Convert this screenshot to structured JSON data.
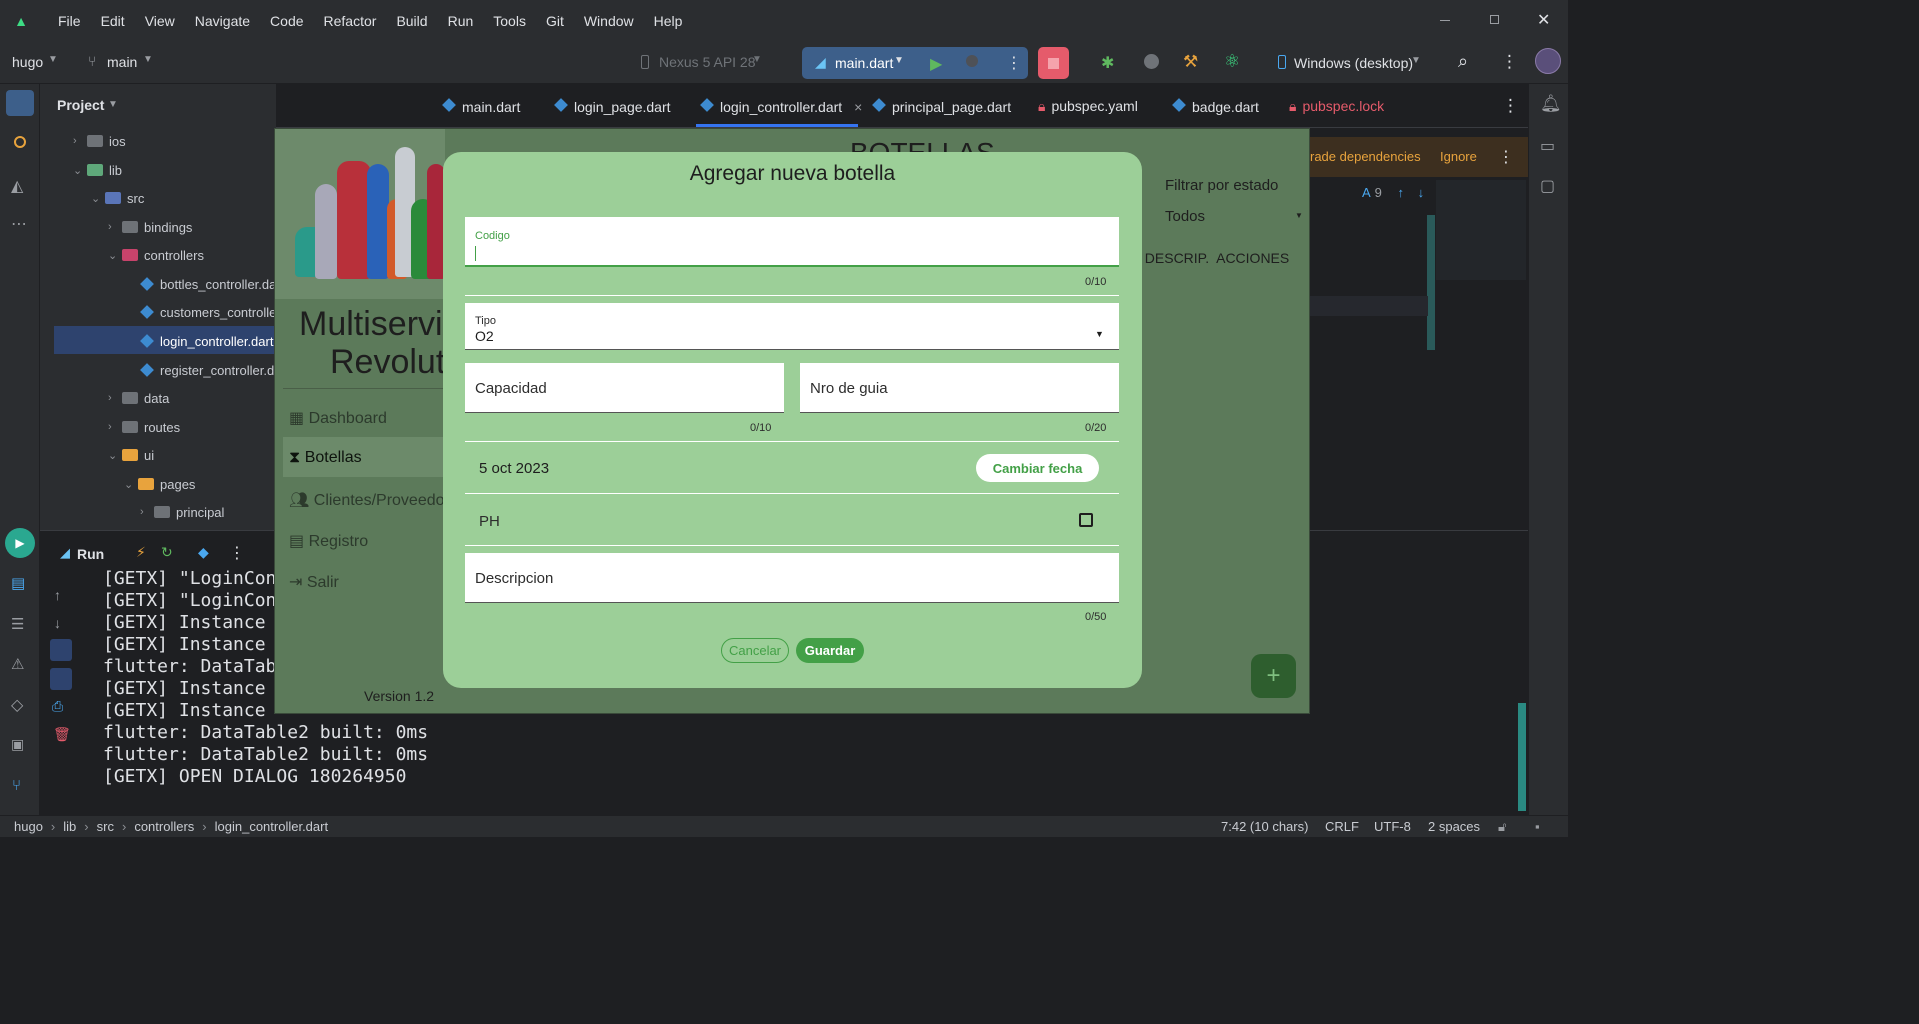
{
  "menubar": {
    "items": [
      "File",
      "Edit",
      "View",
      "Navigate",
      "Code",
      "Refactor",
      "Build",
      "Run",
      "Tools",
      "Git",
      "Window",
      "Help"
    ]
  },
  "toolbar": {
    "project": "hugo",
    "branch": "main",
    "device": "Nexus 5 API 28",
    "run_config": "main.dart",
    "target": "Windows (desktop)"
  },
  "project_panel": {
    "title": "Project",
    "tree": [
      {
        "label": "ios",
        "kind": "folder"
      },
      {
        "label": "lib",
        "kind": "folder"
      },
      {
        "label": "src",
        "kind": "folder"
      },
      {
        "label": "bindings",
        "kind": "folder"
      },
      {
        "label": "controllers",
        "kind": "folder"
      },
      {
        "label": "bottles_controller.dart",
        "kind": "file"
      },
      {
        "label": "customers_controller.dart",
        "kind": "file"
      },
      {
        "label": "login_controller.dart",
        "kind": "file"
      },
      {
        "label": "register_controller.dart",
        "kind": "file"
      },
      {
        "label": "data",
        "kind": "folder"
      },
      {
        "label": "routes",
        "kind": "folder"
      },
      {
        "label": "ui",
        "kind": "folder"
      },
      {
        "label": "pages",
        "kind": "folder"
      },
      {
        "label": "principal",
        "kind": "folder"
      }
    ]
  },
  "editor_tabs": [
    {
      "label": "main.dart"
    },
    {
      "label": "login_page.dart"
    },
    {
      "label": "login_controller.dart",
      "close": "×"
    },
    {
      "label": "principal_page.dart"
    },
    {
      "label": "pubspec.yaml"
    },
    {
      "label": "badge.dart"
    },
    {
      "label": "pubspec.lock"
    }
  ],
  "editor_notice": {
    "upgrade": "rade dependencies",
    "ignore": "Ignore",
    "inspection_count": "9"
  },
  "run_panel": {
    "tab": "Run",
    "console": [
      "[GETX] \"LoginCont",
      "[GETX] \"LoginCont",
      "[GETX] Instance \"",
      "[GETX] Instance \"",
      "flutter: DataTable",
      "[GETX] Instance \"",
      "[GETX] Instance \"",
      "flutter: DataTable2 built: 0ms",
      "flutter: DataTable2 built: 0ms",
      "[GETX] OPEN DIALOG 180264950"
    ]
  },
  "statusbar": {
    "breadcrumb": [
      "hugo",
      "lib",
      "src",
      "controllers",
      "login_controller.dart"
    ],
    "position": "7:42 (10 chars)",
    "line_sep": "CRLF",
    "encoding": "UTF-8",
    "indent": "2 spaces"
  },
  "app": {
    "header_title": "BOTELLAS",
    "company_line1": "Multiservi",
    "company_line2": "Revoluti",
    "nav": [
      "Dashboard",
      "Botellas",
      "Clientes/Proveedo",
      "Registro",
      "Salir"
    ],
    "version": "Version 1.2",
    "filter_label": "Filtrar por estado",
    "filter_value": "Todos",
    "columns": ". DESCRIP.  ACCIONES",
    "fab": "+"
  },
  "dialog": {
    "title": "Agregar nueva botella",
    "codigo_label": "Codigo",
    "codigo_counter": "0/10",
    "tipo_label": "Tipo",
    "tipo_value": "O2",
    "capacidad_label": "Capacidad",
    "capacidad_counter": "0/10",
    "guia_label": "Nro de guia",
    "guia_counter": "0/20",
    "date": "5 oct 2023",
    "change_date": "Cambiar fecha",
    "ph_label": "PH",
    "descripcion_label": "Descripcion",
    "descripcion_counter": "0/50",
    "cancel": "Cancelar",
    "save": "Guardar"
  },
  "colors": {
    "ide_bg": "#1e1f22",
    "ide_panel": "#2b2d30",
    "dialog_bg": "#9ccf98",
    "save_button": "#43a047",
    "stop_button": "#e55b6b"
  }
}
